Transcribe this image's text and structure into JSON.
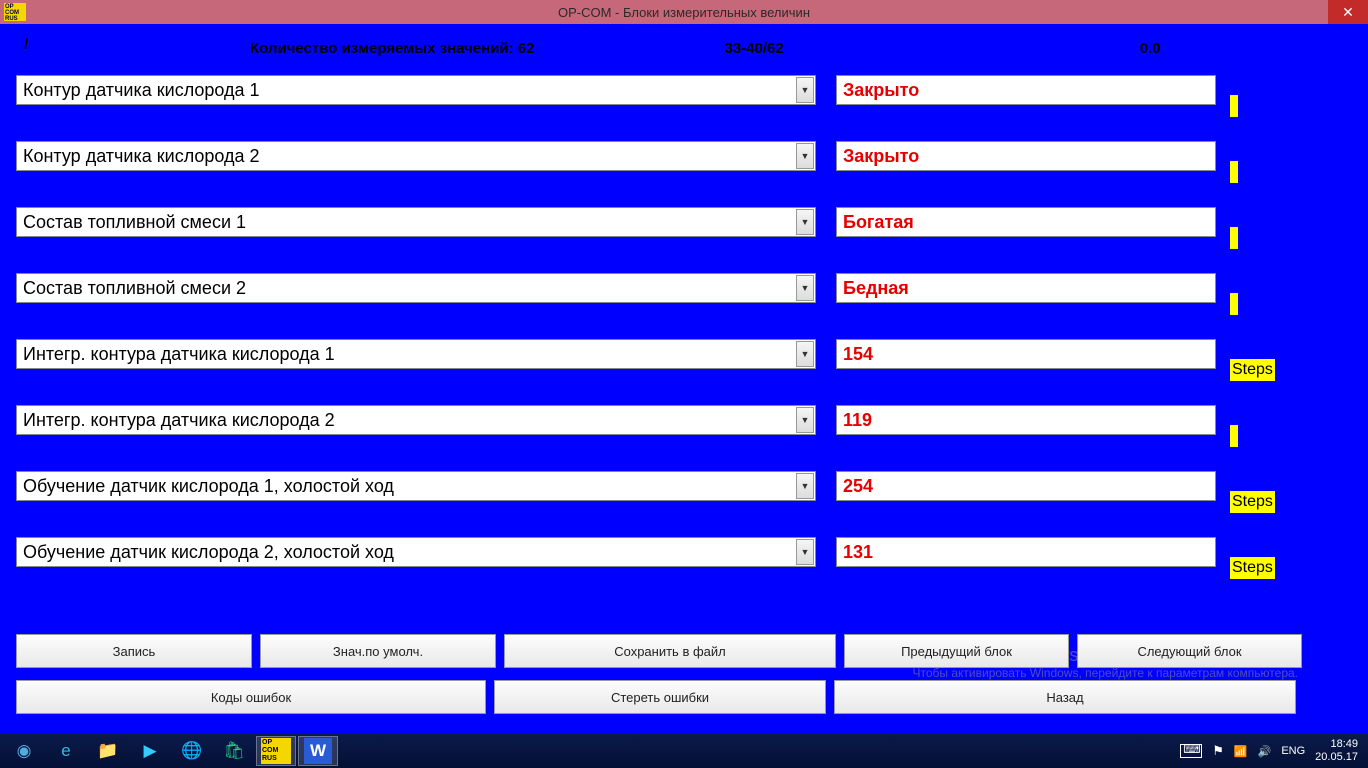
{
  "window": {
    "title": "OP-COM - Блоки измерительных величин",
    "icon_text": "OP\nCOM\nRUS"
  },
  "header": {
    "count_label": "Количество измеряемых значений: 62",
    "range": "33-40/62",
    "right_val": "0.0"
  },
  "rows": [
    {
      "param": "Контур датчика кислорода 1",
      "value": "Закрыто",
      "unit": ""
    },
    {
      "param": "Контур датчика кислорода 2",
      "value": "Закрыто",
      "unit": ""
    },
    {
      "param": "Состав топливной смеси 1",
      "value": "Богатая",
      "unit": ""
    },
    {
      "param": "Состав топливной смеси 2",
      "value": "Бедная",
      "unit": ""
    },
    {
      "param": "Интегр. контура датчика кислорода 1",
      "value": "154",
      "unit": "Steps"
    },
    {
      "param": "Интегр. контура датчика кислорода 2",
      "value": "119",
      "unit": ""
    },
    {
      "param": "Обучение датчик кислорода 1, холостой ход",
      "value": "254",
      "unit": "Steps"
    },
    {
      "param": "Обучение датчик кислорода 2, холостой ход",
      "value": "131",
      "unit": "Steps"
    }
  ],
  "buttons": {
    "record": "Запись",
    "defaults": "Знач.по умолч.",
    "save_file": "Сохранить в файл",
    "prev_block": "Предыдущий блок",
    "next_block": "Следующий блок",
    "fault_codes": "Коды ошибок",
    "clear_faults": "Стереть ошибки",
    "back": "Назад"
  },
  "watermark": {
    "line1": "Активация Windows",
    "line2": "Чтобы активировать Windows, перейдите к параметрам компьютера."
  },
  "taskbar": {
    "lang": "ENG",
    "time": "18:49",
    "date": "20.05.17",
    "opcom_icon_text": "OP\nCOM\nRUS"
  }
}
